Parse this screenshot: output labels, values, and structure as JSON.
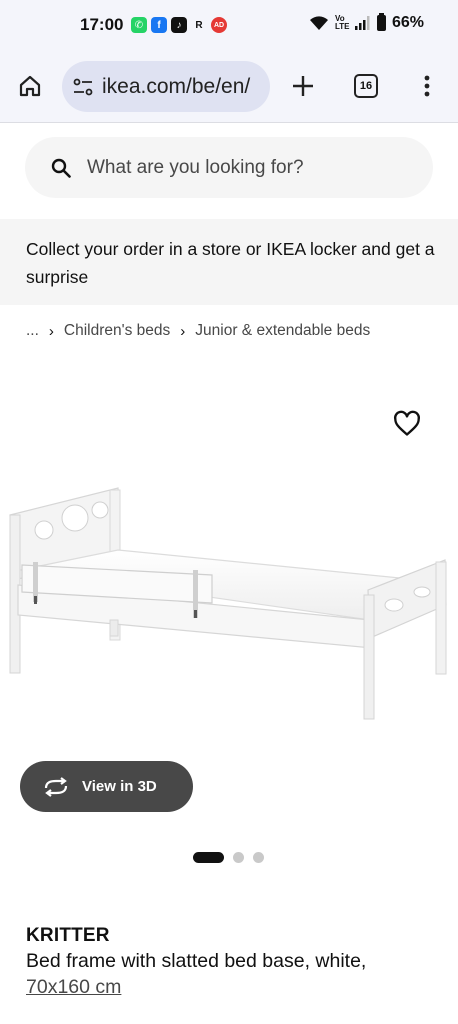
{
  "status_bar": {
    "time": "17:00",
    "notification_icons": [
      {
        "name": "whatsapp-icon",
        "glyph": "✆",
        "color": "#25d366"
      },
      {
        "name": "facebook-icon",
        "glyph": "f",
        "color": "#1877f2"
      },
      {
        "name": "tiktok-icon",
        "glyph": "♪",
        "color": "#111111"
      },
      {
        "name": "r-icon",
        "glyph": "R",
        "color": "#f4f5fb"
      },
      {
        "name": "ad-icon",
        "glyph": "AD",
        "color": "#e53935"
      }
    ],
    "network": "Vo LTE",
    "battery": "66%"
  },
  "browser": {
    "url": "ikea.com/be/en/",
    "tab_count": "16"
  },
  "search": {
    "placeholder": "What are you looking for?"
  },
  "banner": {
    "text": "Collect your order in a store or IKEA locker and get a surprise"
  },
  "breadcrumb": {
    "ellipsis": "...",
    "items": [
      "Children's beds",
      "Junior & extendable beds"
    ]
  },
  "gallery": {
    "view_3d_label": "View in 3D",
    "image_count": 3,
    "active_index": 0
  },
  "product": {
    "name": "KRITTER",
    "description": "Bed frame with slatted bed base, white,",
    "size": "70x160 cm"
  },
  "colors": {
    "accent_dark": "#484848",
    "surface": "#f5f5f5",
    "browser_bar": "#f4f5fb"
  }
}
